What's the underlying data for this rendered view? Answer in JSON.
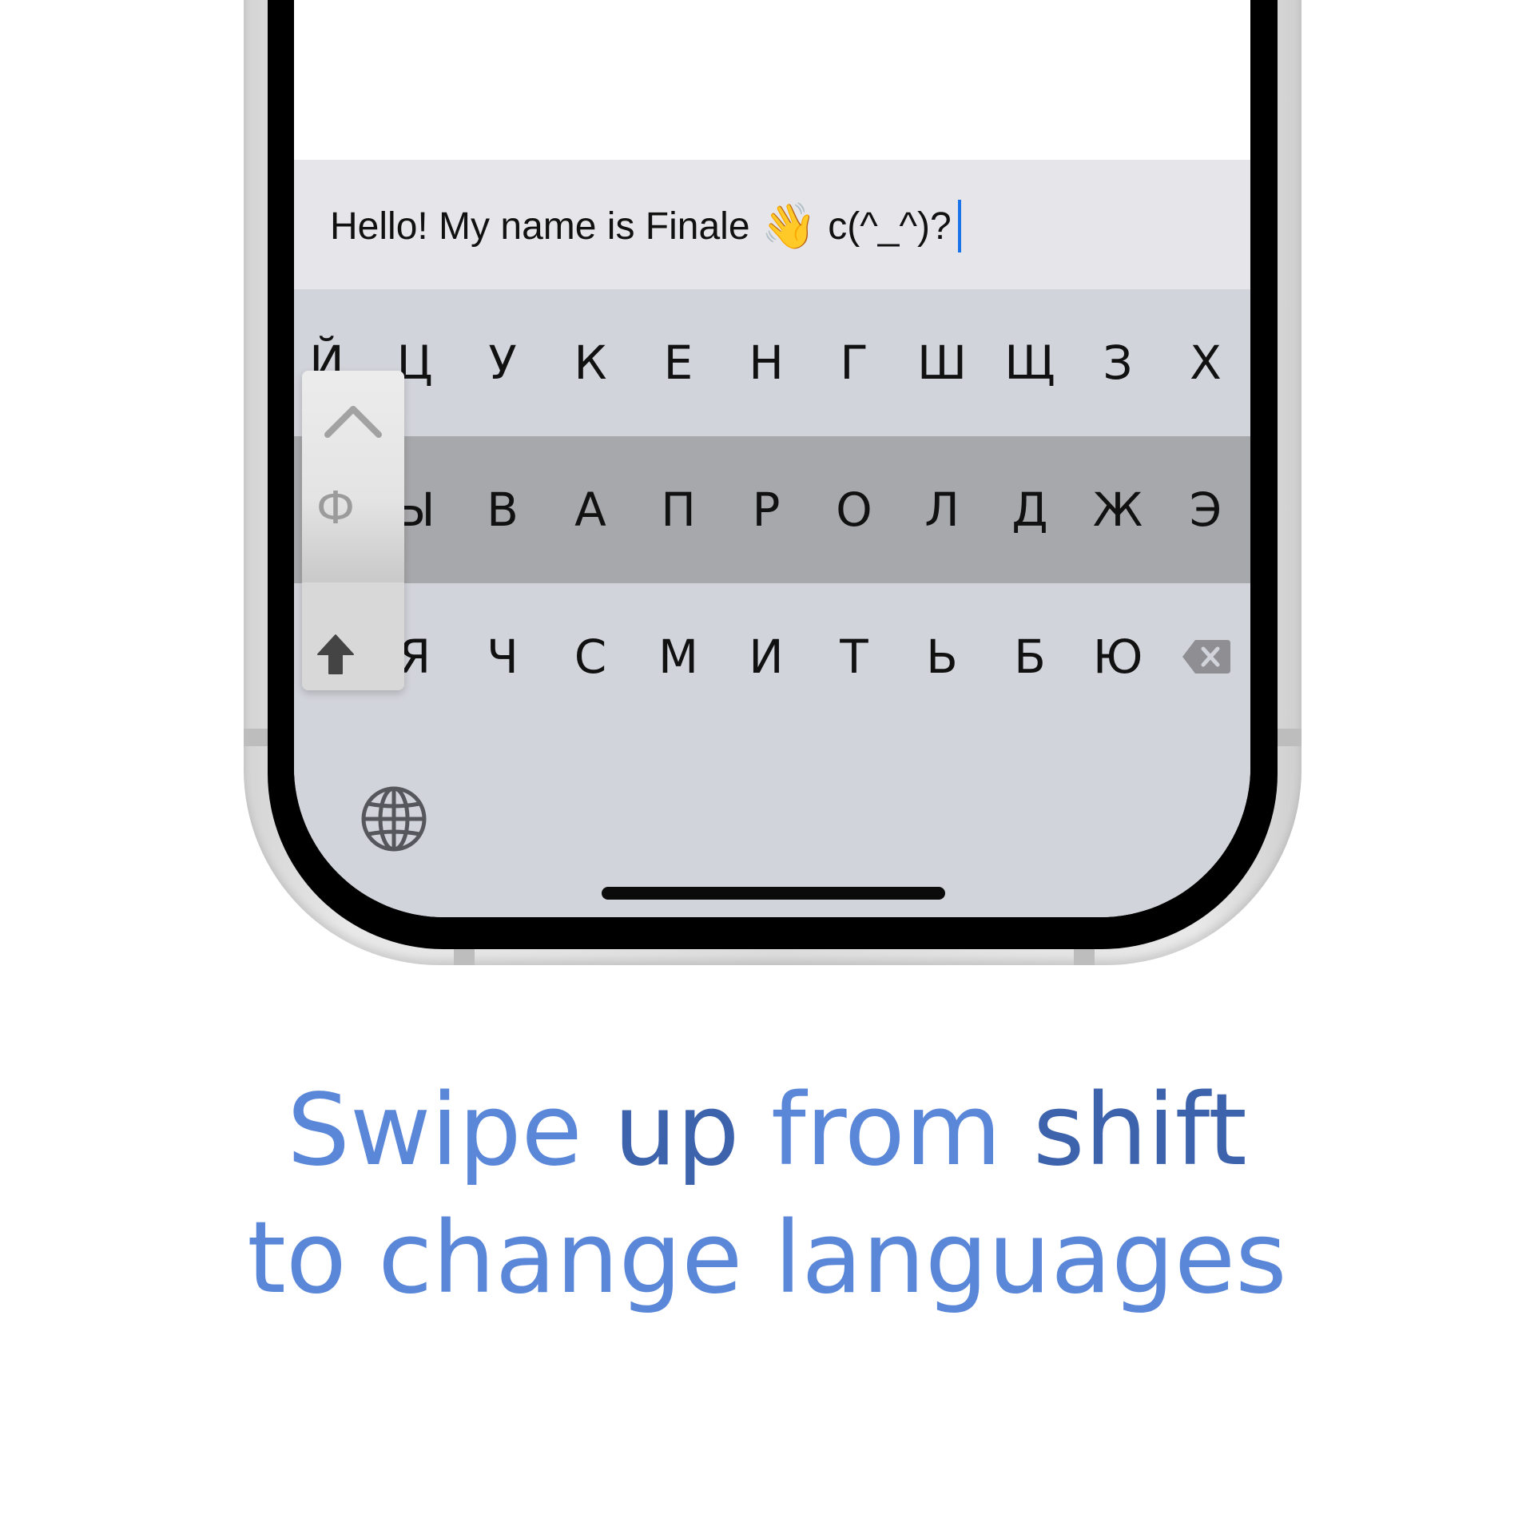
{
  "text_field": {
    "typed_text": "Hello! My name is Finale",
    "emoji": "👋",
    "emoticon": "c(^_^)?"
  },
  "keyboard": {
    "row1": [
      "Й",
      "Ц",
      "У",
      "К",
      "Е",
      "Н",
      "Г",
      "Ш",
      "Щ",
      "З",
      "Х"
    ],
    "row2": [
      "Ы",
      "В",
      "А",
      "П",
      "Р",
      "О",
      "Л",
      "Д",
      "Ж",
      "Э"
    ],
    "row3": [
      "Я",
      "Ч",
      "С",
      "М",
      "И",
      "Т",
      "Ь",
      "Б",
      "Ю"
    ],
    "popup_letter": "Ф"
  },
  "caption": {
    "line1": {
      "w1": "Swipe",
      "w2": "up",
      "w3": "from",
      "w4": "shift"
    },
    "line2": "to change languages"
  },
  "colors": {
    "caption_light": "#5b87d9",
    "caption_dark": "#3e63ad",
    "caret": "#1a73e8"
  }
}
